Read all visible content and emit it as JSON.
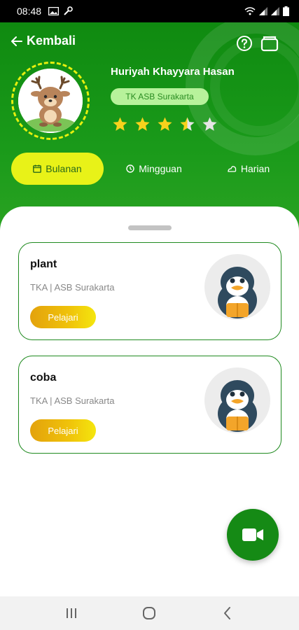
{
  "status_bar": {
    "time": "08:48",
    "left_icons": [
      "image-icon",
      "wrench-icon"
    ],
    "right_icons": [
      "wifi-icon",
      "signal-icon",
      "signal-icon",
      "battery-icon"
    ]
  },
  "header": {
    "back_label": "Kembali",
    "user_name": "Huriyah Khayyara Hasan",
    "school": "TK ASB Surakarta",
    "rating": {
      "value": 3.5,
      "max": 5
    },
    "colors": {
      "primary_green": "#158a15",
      "accent_yellow": "#e8f218",
      "badge_bg": "#b7f29b"
    }
  },
  "tabs": [
    {
      "label": "Bulanan",
      "icon": "calendar-icon",
      "active": true
    },
    {
      "label": "Mingguan",
      "icon": "week-icon",
      "active": false
    },
    {
      "label": "Harian",
      "icon": "day-icon",
      "active": false
    }
  ],
  "cards": [
    {
      "title": "plant",
      "subtitle": "TKA | ASB Surakarta",
      "button": "Pelajari",
      "image": "penguin-icon"
    },
    {
      "title": "coba",
      "subtitle": "TKA | ASB Surakarta",
      "button": "Pelajari",
      "image": "penguin-icon"
    }
  ],
  "fab": {
    "icon": "video-camera-icon"
  },
  "nav": {
    "buttons": [
      "recent-apps-icon",
      "home-icon",
      "back-icon"
    ]
  }
}
